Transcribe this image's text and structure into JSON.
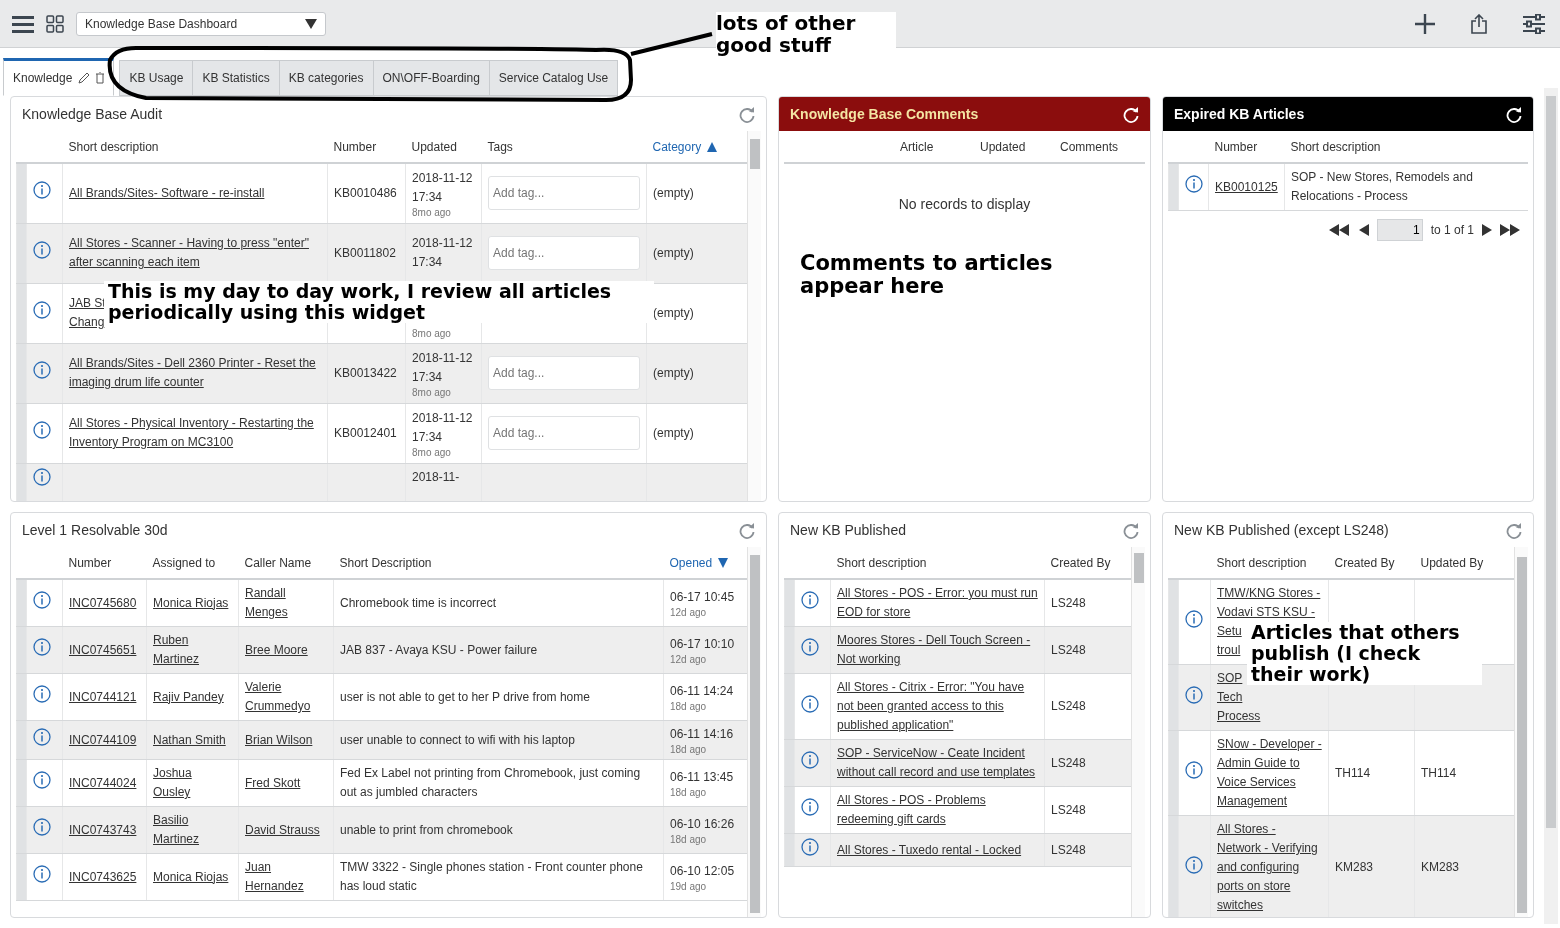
{
  "header": {
    "dashboard_select": "Knowledge Base Dashboard"
  },
  "tabs": [
    {
      "label": "Knowledge",
      "selected": true,
      "editable": true
    },
    {
      "label": "KB Usage",
      "selected": false
    },
    {
      "label": "KB Statistics",
      "selected": false
    },
    {
      "label": "KB categories",
      "selected": false
    },
    {
      "label": "ON\\OFF-Boarding",
      "selected": false
    },
    {
      "label": "Service Catalog Use",
      "selected": false
    }
  ],
  "widgets": [
    {
      "kind": "plain",
      "title": "Knowledge Base Audit",
      "columns": [
        {
          "label": "Short description",
          "sorted": false
        },
        {
          "label": "Number",
          "sorted": false
        },
        {
          "label": "Updated",
          "sorted": false
        },
        {
          "label": "Tags",
          "sorted": false
        },
        {
          "label": "Category",
          "sorted": true,
          "descending": false
        }
      ],
      "rows": [
        {
          "cells": [
            {
              "kind": "link",
              "text": "All Brands/Sites- Software - re-install"
            },
            {
              "kind": "text",
              "text": "KB0010486"
            },
            {
              "kind": "date",
              "text": "2018-11-12 17:34",
              "ago": "8mo ago"
            },
            {
              "kind": "tag",
              "placeholder": "Add tag..."
            },
            {
              "kind": "text",
              "text": "(empty)"
            }
          ]
        },
        {
          "cells": [
            {
              "kind": "link",
              "text": "All Stores - Scanner - Having to press \"enter\" after scanning each item"
            },
            {
              "kind": "text",
              "text": "KB0011802"
            },
            {
              "kind": "date",
              "text": "2018-11-12 17:34"
            },
            {
              "kind": "tag",
              "placeholder": "Add tag..."
            },
            {
              "kind": "text",
              "text": "(empty)"
            }
          ]
        },
        {
          "cells": [
            {
              "kind": "link",
              "lines": [
                "JAB St",
                "Chang"
              ]
            },
            {
              "kind": "empty"
            },
            {
              "kind": "date",
              "ago": "8mo ago"
            },
            {
              "kind": "empty"
            },
            {
              "kind": "text",
              "text": "(empty)"
            }
          ]
        },
        {
          "cells": [
            {
              "kind": "link",
              "text": "All Brands/Sites - Dell 2360 Printer - Reset the imaging drum life counter"
            },
            {
              "kind": "text",
              "text": "KB0013422"
            },
            {
              "kind": "date",
              "text": "2018-11-12 17:34",
              "ago": "8mo ago"
            },
            {
              "kind": "tag",
              "placeholder": "Add tag..."
            },
            {
              "kind": "text",
              "text": "(empty)"
            }
          ]
        },
        {
          "cells": [
            {
              "kind": "link",
              "text": "All Stores - Physical Inventory - Restarting the Inventory Program on MC3100"
            },
            {
              "kind": "text",
              "text": "KB0012401"
            },
            {
              "kind": "date",
              "text": "2018-11-12 17:34",
              "ago": "8mo ago"
            },
            {
              "kind": "tag",
              "placeholder": "Add tag..."
            },
            {
              "kind": "text",
              "text": "(empty)"
            }
          ]
        },
        {
          "cells": [
            {
              "kind": "empty"
            },
            {
              "kind": "empty"
            },
            {
              "kind": "date",
              "text": "2018-11-"
            },
            {
              "kind": "empty"
            },
            {
              "kind": "empty"
            }
          ]
        }
      ]
    },
    {
      "kind": "red",
      "title": "Knowledge Base Comments",
      "columns": [
        {
          "label": "Article",
          "sorted": false
        },
        {
          "label": "Updated",
          "sorted": false
        },
        {
          "label": "Comments",
          "sorted": false
        }
      ],
      "empty_message": "No records to display"
    },
    {
      "kind": "black",
      "title": "Expired KB Articles",
      "columns": [
        {
          "label": "Number",
          "sorted": false
        },
        {
          "label": "Short description",
          "sorted": false
        }
      ],
      "rows": [
        {
          "cells": [
            {
              "kind": "link",
              "text": "KB0010125"
            },
            {
              "kind": "text",
              "text": "SOP - New Stores, Remodels and Relocations - Process"
            }
          ]
        }
      ],
      "pagination": {
        "page": "1",
        "range": "to 1 of 1"
      }
    },
    {
      "kind": "plain",
      "title": "Level 1 Resolvable 30d",
      "columns": [
        {
          "label": "Number",
          "sorted": false
        },
        {
          "label": "Assigned to",
          "sorted": false
        },
        {
          "label": "Caller Name",
          "sorted": false
        },
        {
          "label": "Short Description",
          "sorted": false
        },
        {
          "label": "Opened",
          "sorted": true,
          "descending": true
        }
      ],
      "rows": [
        {
          "cells": [
            {
              "kind": "link",
              "text": "INC0745680"
            },
            {
              "kind": "link",
              "text": "Monica Riojas"
            },
            {
              "kind": "link",
              "text": "Randall Menges"
            },
            {
              "kind": "text",
              "text": "Chromebook time is incorrect"
            },
            {
              "kind": "date",
              "text": "06-17 10:45",
              "ago": "12d ago"
            }
          ]
        },
        {
          "cells": [
            {
              "kind": "link",
              "text": "INC0745651"
            },
            {
              "kind": "link",
              "text": "Ruben Martinez"
            },
            {
              "kind": "link",
              "text": "Bree Moore"
            },
            {
              "kind": "text",
              "text": "JAB 837 - Avaya KSU - Power failure"
            },
            {
              "kind": "date",
              "text": "06-17 10:10",
              "ago": "12d ago"
            }
          ]
        },
        {
          "cells": [
            {
              "kind": "link",
              "text": "INC0744121"
            },
            {
              "kind": "link",
              "text": "Rajiv Pandey"
            },
            {
              "kind": "link",
              "text": "Valerie Crummedyo"
            },
            {
              "kind": "text",
              "text": "user is not able to get to her P drive from home"
            },
            {
              "kind": "date",
              "text": "06-11 14:24",
              "ago": "18d ago"
            }
          ]
        },
        {
          "cells": [
            {
              "kind": "link",
              "text": "INC0744109"
            },
            {
              "kind": "link",
              "text": "Nathan Smith"
            },
            {
              "kind": "link",
              "text": "Brian Wilson"
            },
            {
              "kind": "text",
              "text": "user unable to connect to wifi with his laptop"
            },
            {
              "kind": "date",
              "text": "06-11 14:16",
              "ago": "18d ago"
            }
          ]
        },
        {
          "cells": [
            {
              "kind": "link",
              "text": "INC0744024"
            },
            {
              "kind": "link",
              "text": "Joshua Ousley"
            },
            {
              "kind": "link",
              "text": "Fred Skott"
            },
            {
              "kind": "text",
              "text": "Fed Ex Label not printing from Chromebook, just coming out as jumbled characters"
            },
            {
              "kind": "date",
              "text": "06-11 13:45",
              "ago": "18d ago"
            }
          ]
        },
        {
          "cells": [
            {
              "kind": "link",
              "text": "INC0743743"
            },
            {
              "kind": "link",
              "text": "Basilio Martinez"
            },
            {
              "kind": "link",
              "text": "David Strauss"
            },
            {
              "kind": "text",
              "text": "unable to print from chromebook"
            },
            {
              "kind": "date",
              "text": "06-10 16:26",
              "ago": "18d ago"
            }
          ]
        },
        {
          "cells": [
            {
              "kind": "link",
              "text": "INC0743625"
            },
            {
              "kind": "link",
              "text": "Monica Riojas"
            },
            {
              "kind": "link",
              "text": "Juan Hernandez"
            },
            {
              "kind": "text",
              "text": "TMW 3322 - Single phones station - Front counter phone has loud static"
            },
            {
              "kind": "date",
              "text": "06-10 12:05",
              "ago": "19d ago"
            }
          ]
        }
      ]
    },
    {
      "kind": "plain",
      "title": "New KB Published",
      "columns": [
        {
          "label": "Short description",
          "sorted": false
        },
        {
          "label": "Created By",
          "sorted": false
        }
      ],
      "rows": [
        {
          "cells": [
            {
              "kind": "link",
              "text": "All Stores - POS - Error: you must run EOD for store"
            },
            {
              "kind": "text",
              "text": "LS248"
            }
          ]
        },
        {
          "cells": [
            {
              "kind": "link",
              "text": "Moores Stores - Dell Touch Screen - Not working"
            },
            {
              "kind": "text",
              "text": "LS248"
            }
          ]
        },
        {
          "cells": [
            {
              "kind": "link",
              "text": "All Stores - Citrix - Error: \"You have not been granted access to this published application\""
            },
            {
              "kind": "text",
              "text": "LS248"
            }
          ]
        },
        {
          "cells": [
            {
              "kind": "link",
              "text": "SOP - ServiceNow - Ceate Incident without call record and use templates"
            },
            {
              "kind": "text",
              "text": "LS248"
            }
          ]
        },
        {
          "cells": [
            {
              "kind": "link",
              "text": "All Stores - POS - Problems redeeming gift cards"
            },
            {
              "kind": "text",
              "text": "LS248"
            }
          ]
        },
        {
          "cells": [
            {
              "kind": "link",
              "text": "All Stores - Tuxedo rental - Locked"
            },
            {
              "kind": "text",
              "text": "LS248"
            }
          ]
        }
      ]
    },
    {
      "kind": "plain",
      "title": "New KB Published (except LS248)",
      "columns": [
        {
          "label": "Short description",
          "sorted": false
        },
        {
          "label": "Created By",
          "sorted": false
        },
        {
          "label": "Updated By",
          "sorted": false
        }
      ],
      "rows": [
        {
          "cells": [
            {
              "kind": "link",
              "lines": [
                "TMW/KNG Stores -",
                "Vodavi STS KSU -",
                "Setu",
                "troul"
              ]
            },
            {
              "kind": "empty"
            },
            {
              "kind": "empty"
            }
          ]
        },
        {
          "cells": [
            {
              "kind": "link",
              "lines": [
                "SOP",
                "Tech",
                "Process"
              ]
            },
            {
              "kind": "empty"
            },
            {
              "kind": "empty"
            }
          ]
        },
        {
          "cells": [
            {
              "kind": "link",
              "text": "SNow - Developer - Admin Guide to Voice Services Management"
            },
            {
              "kind": "text",
              "text": "TH114"
            },
            {
              "kind": "text",
              "text": "TH114"
            }
          ]
        },
        {
          "cells": [
            {
              "kind": "link",
              "text": "All Stores - Network - Verifying and configuring ports on store switches"
            },
            {
              "kind": "text",
              "text": "KM283"
            },
            {
              "kind": "text",
              "text": "KM283"
            }
          ]
        }
      ]
    }
  ],
  "annotations": [
    {
      "text": "lots of other good stuff"
    },
    {
      "text": "This is my day to day work, I review all articles periodically using this widget"
    },
    {
      "text": "Comments to articles appear here"
    },
    {
      "text": "Articles that others publish (I check their work)"
    }
  ]
}
